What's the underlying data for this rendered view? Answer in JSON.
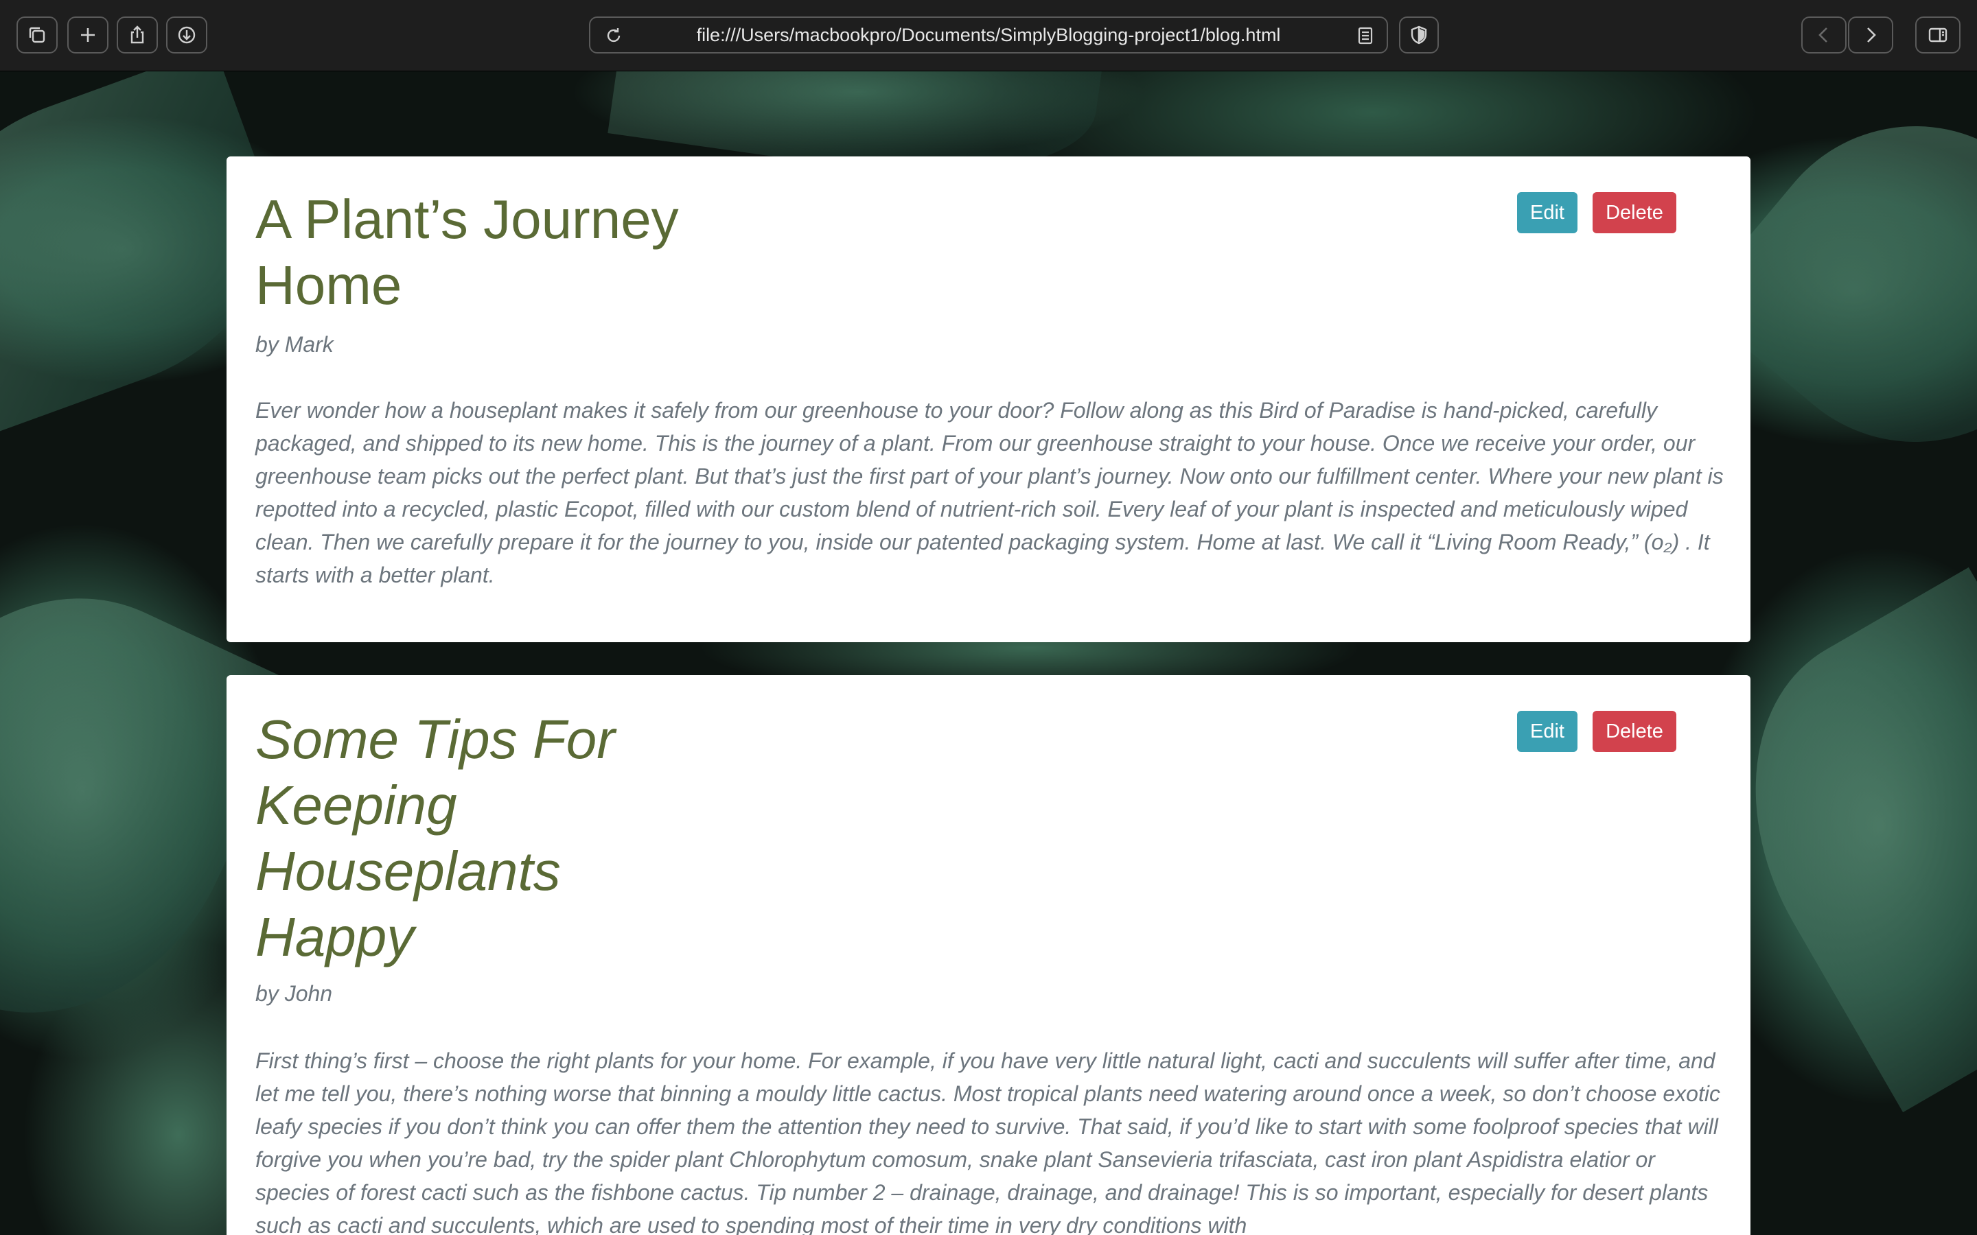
{
  "browser": {
    "url": "file:///Users/macbookpro/Documents/SimplyBlogging-project1/blog.html",
    "icons": [
      "tab-overview-icon",
      "new-tab-icon",
      "share-icon",
      "download-icon",
      "reload-icon",
      "reader-icon",
      "privacy-shield-icon",
      "back-icon",
      "forward-icon",
      "sidebar-icon"
    ]
  },
  "posts": [
    {
      "title": "A Plant’s Journey Home",
      "author": "by Mark",
      "body": "Ever wonder how a houseplant makes it safely from our greenhouse to your door? Follow along as this Bird of Paradise is hand-picked, carefully packaged, and shipped to its new home. This is the journey of a plant. From our greenhouse straight to your house. Once we receive your order, our greenhouse team picks out the perfect plant. But that’s just the first part of your plant’s journey. Now onto our fulfillment center. Where your new plant is repotted into a recycled, plastic Ecopot, filled with our custom blend of nutrient-rich soil. Every leaf of your plant is inspected and meticulously wiped clean. Then we carefully prepare it for the journey to you, inside our patented packaging system. Home at last. We call it “Living Room Ready,” (o₂) . It starts with a better plant.",
      "edit_label": "Edit",
      "delete_label": "Delete"
    },
    {
      "title": "Some Tips For Keeping Houseplants Happy",
      "author": "by John",
      "body": "First thing’s first – choose the right plants for your home. For example, if you have very little natural light, cacti and succulents will suffer after time, and let me tell you, there’s nothing worse that binning a mouldy little cactus. Most tropical plants need watering around once a week, so don’t choose exotic leafy species if you don’t think you can offer them the attention they need to survive. That said, if you’d like to start with some foolproof species that will forgive you when you’re bad, try the spider plant Chlorophytum comosum, snake plant Sansevieria trifasciata, cast iron plant Aspidistra elatior or species of forest cacti such as the fishbone cactus. Tip number 2 – drainage, drainage, and drainage! This is so important, especially for desert plants such as cacti and succulents, which are used to spending most of their time in very dry conditions with",
      "edit_label": "Edit",
      "delete_label": "Delete"
    }
  ],
  "colors": {
    "title": "#5a6a35",
    "text_muted": "#6c757d",
    "edit_button": "#3aa0b3",
    "delete_button": "#d2424d",
    "toolbar": "#1e1e1e"
  }
}
